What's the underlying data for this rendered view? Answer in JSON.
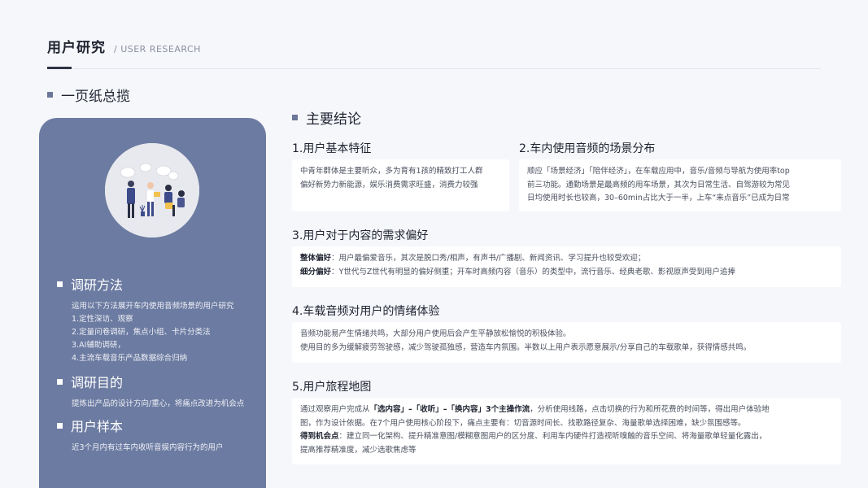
{
  "header": {
    "title": "用户研究",
    "subtitle": "/  USER RESEARCH"
  },
  "section_label": "一页纸总揽",
  "left_panel": {
    "methods": {
      "title": "调研方法",
      "lines": [
        "运用以下方法展开车内使用音频场景的用户研究",
        "1.定性深访、观察",
        "2.定量问卷调研，焦点小组、卡片分类法",
        "3.AI辅助调研，",
        "4.主流车载音乐产品数据综合归纳"
      ]
    },
    "goal": {
      "title": "调研目的",
      "lines": [
        "提炼出产品的设计方向/重心，将痛点改进为机会点"
      ]
    },
    "sample": {
      "title": "用户样本",
      "lines": [
        "近3个月内有过车内收听音娱内容行为的用户"
      ]
    }
  },
  "main": {
    "title": "主要结论",
    "s1": {
      "title": "1.用户基本特征",
      "lines": [
        "中青年群体是主要听众，多为育有1孩的精致打工人群",
        "偏好新势力新能源，娱乐消费需求旺盛，消费力较强"
      ]
    },
    "s2": {
      "title": "2.车内使用音频的场景分布",
      "lines": [
        "顺应「场景经济」「陪伴经济」，在车载应用中，音乐/音频与导航为使用率top",
        "前三功能。通勤场景是最高频的用车场景，其次为日常生活、自驾游较为常见",
        "日均使用时长也较高，30–60min占比大于一半，上车“来点音乐”已成为日常"
      ]
    },
    "s3": {
      "title": "3.用户对于内容的需求偏好",
      "line1_label": "整体偏好",
      "line1_text": "：用户最偏爱音乐，其次是脱口秀/相声，有声书/广播剧、新闻资讯、学习提升也较受欢迎；",
      "line2_label": "细分偏好",
      "line2_text": "：Y世代与Z世代有明显的偏好侧重；开车时高频内容（音乐）的类型中，流行音乐、经典老歌、影视原声受到用户追捧"
    },
    "s4": {
      "title": "4.车载音频对用户的情绪体验",
      "lines": [
        "音频功能易产生情绪共鸣，大部分用户使用后会产生平静放松愉悦的积极体验。",
        "使用目的多为缓解疲劳驾驶感，减少驾驶孤独感，营造车内氛围。半数以上用户表示愿意展示/分享自己的车载歌单，获得情感共鸣。"
      ]
    },
    "s5": {
      "title": "5.用户旅程地图",
      "l1_pre": "通过观察用户完成从",
      "l1_bold": "「选内容」–「收听」–「换内容」3个主操作流",
      "l1_post": "，分析使用线路，点击切换的行为和所花费的时间等，得出用户体验地",
      "l2": "图，作为设计依据。在7个用户使用核心阶段下，痛点主要有：切音源时间长、找歌路径复杂、海量歌单选择困难，缺少氛围感等。",
      "l3_label": "得到机会点",
      "l3_text": "：建立同一化架构、提升精准意图/模糊意图用户的区分度、利用车内硬件打造视听嗅触的音乐空间、将海量歌单轻量化露出，",
      "l4": "提高推荐精准度，减少选歌焦虑等"
    }
  },
  "colors": {
    "panel": "#6c7ba1",
    "bullet": "#6b7798",
    "background": "#f6f7fb"
  }
}
